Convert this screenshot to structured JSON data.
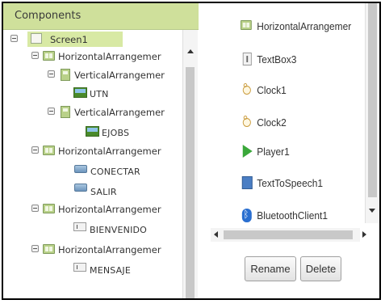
{
  "panel": {
    "title": "Components"
  },
  "tree": {
    "screen1": "Screen1",
    "ha1": "HorizontalArrangemer",
    "va1": "VerticalArrangemer",
    "utn": "UTN",
    "va2": "VerticalArrangemer",
    "ejobs": "EJOBS",
    "ha2": "HorizontalArrangemer",
    "conectar": "CONECTAR",
    "salir": "SALIR",
    "ha3": "HorizontalArrangemer",
    "bienvenido": "BIENVENIDO",
    "ha4": "HorizontalArrangemer",
    "mensaje": "MENSAJE"
  },
  "right_list": {
    "ha": "HorizontalArrangemer",
    "textbox3": "TextBox3",
    "clock1": "Clock1",
    "clock2": "Clock2",
    "player1": "Player1",
    "tts1": "TextToSpeech1",
    "bt1": "BluetoothClient1"
  },
  "buttons": {
    "rename": "Rename",
    "delete": "Delete"
  },
  "colors": {
    "header_bg": "#cfe09b",
    "selected_bg": "#d8e9a4"
  }
}
